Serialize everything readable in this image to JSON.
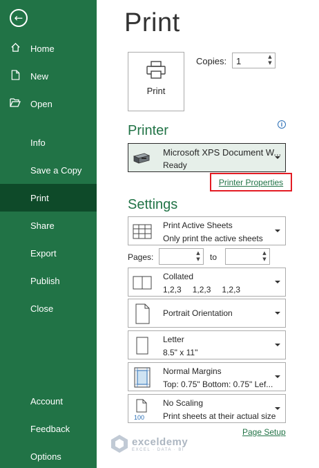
{
  "sidebar": {
    "back_icon": "arrow-left-icon",
    "items": [
      {
        "label": "Home",
        "icon": "home-icon"
      },
      {
        "label": "New",
        "icon": "new-doc-icon"
      },
      {
        "label": "Open",
        "icon": "folder-open-icon"
      },
      {
        "label": "Info"
      },
      {
        "label": "Save a Copy"
      },
      {
        "label": "Print"
      },
      {
        "label": "Share"
      },
      {
        "label": "Export"
      },
      {
        "label": "Publish"
      },
      {
        "label": "Close"
      },
      {
        "label": "Account"
      },
      {
        "label": "Feedback"
      },
      {
        "label": "Options"
      }
    ],
    "active": "Print"
  },
  "main": {
    "title": "Print",
    "print_button_label": "Print",
    "copies_label": "Copies:",
    "copies_value": "1",
    "printer_heading": "Printer",
    "printer": {
      "name": "Microsoft XPS Document W...",
      "status": "Ready"
    },
    "printer_properties_link": "Printer Properties",
    "settings_heading": "Settings",
    "settings": {
      "scope": {
        "line1": "Print Active Sheets",
        "line2": "Only print the active sheets"
      },
      "pages_label": "Pages:",
      "pages_from": "",
      "pages_to_label": "to",
      "pages_to": "",
      "collation": {
        "line1": "Collated",
        "values": [
          "1,2,3",
          "1,2,3",
          "1,2,3"
        ]
      },
      "orientation": {
        "line1": "Portrait Orientation"
      },
      "paper": {
        "line1": "Letter",
        "line2": "8.5\" x 11\""
      },
      "margins": {
        "line1": "Normal Margins",
        "line2": "Top: 0.75\" Bottom: 0.75\" Lef..."
      },
      "scaling": {
        "line1": "No Scaling",
        "line2": "Print sheets at their actual size",
        "icon_text": "100"
      }
    },
    "page_setup_link": "Page Setup"
  },
  "watermark": {
    "name": "exceldemy",
    "tagline": "EXCEL · DATA · BI"
  },
  "colors": {
    "accent": "#217346",
    "sidebar_active": "#0e4a29",
    "highlight_box": "#e31b23",
    "printer_bg": "#e6efe9"
  }
}
